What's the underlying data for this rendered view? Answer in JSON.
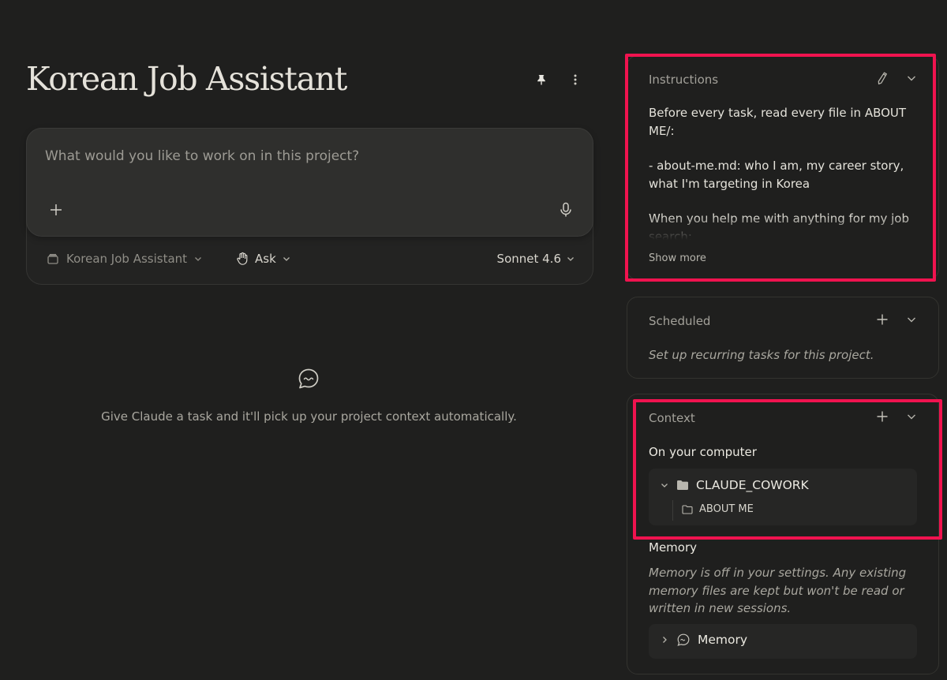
{
  "header": {
    "title": "Korean Job Assistant"
  },
  "composer": {
    "placeholder": "What would you like to work on in this project?",
    "project_label": "Korean Job Assistant",
    "mode_label": "Ask",
    "model_label": "Sonnet 4.6"
  },
  "empty_state": {
    "text": "Give Claude a task and it'll pick up your project context automatically."
  },
  "instructions": {
    "title": "Instructions",
    "paragraphs": [
      "Before every task, read every file in ABOUT ME/:",
      "- about-me.md: who I am, my career story, what I'm targeting in Korea",
      "When you help me with anything for my job search:"
    ],
    "show_more": "Show more"
  },
  "scheduled": {
    "title": "Scheduled",
    "text": "Set up recurring tasks for this project."
  },
  "context": {
    "title": "Context",
    "on_computer_heading": "On your computer",
    "root_folder": "CLAUDE_COWORK",
    "child_folder": "ABOUT ME",
    "memory_heading": "Memory",
    "memory_text": "Memory is off in your settings. Any existing memory files are kept but won't be read or written in new sessions.",
    "memory_item": "Memory"
  },
  "colors": {
    "background": "#1f1f1e",
    "highlight": "#f0134f"
  },
  "icons": [
    "pin-icon",
    "more-vertical-icon",
    "plus-icon",
    "microphone-icon",
    "project-box-icon",
    "hand-icon",
    "chevron-down-icon",
    "chat-bubble-icon",
    "pencil-icon",
    "folder-icon",
    "memory-icon",
    "chevron-right-icon"
  ]
}
